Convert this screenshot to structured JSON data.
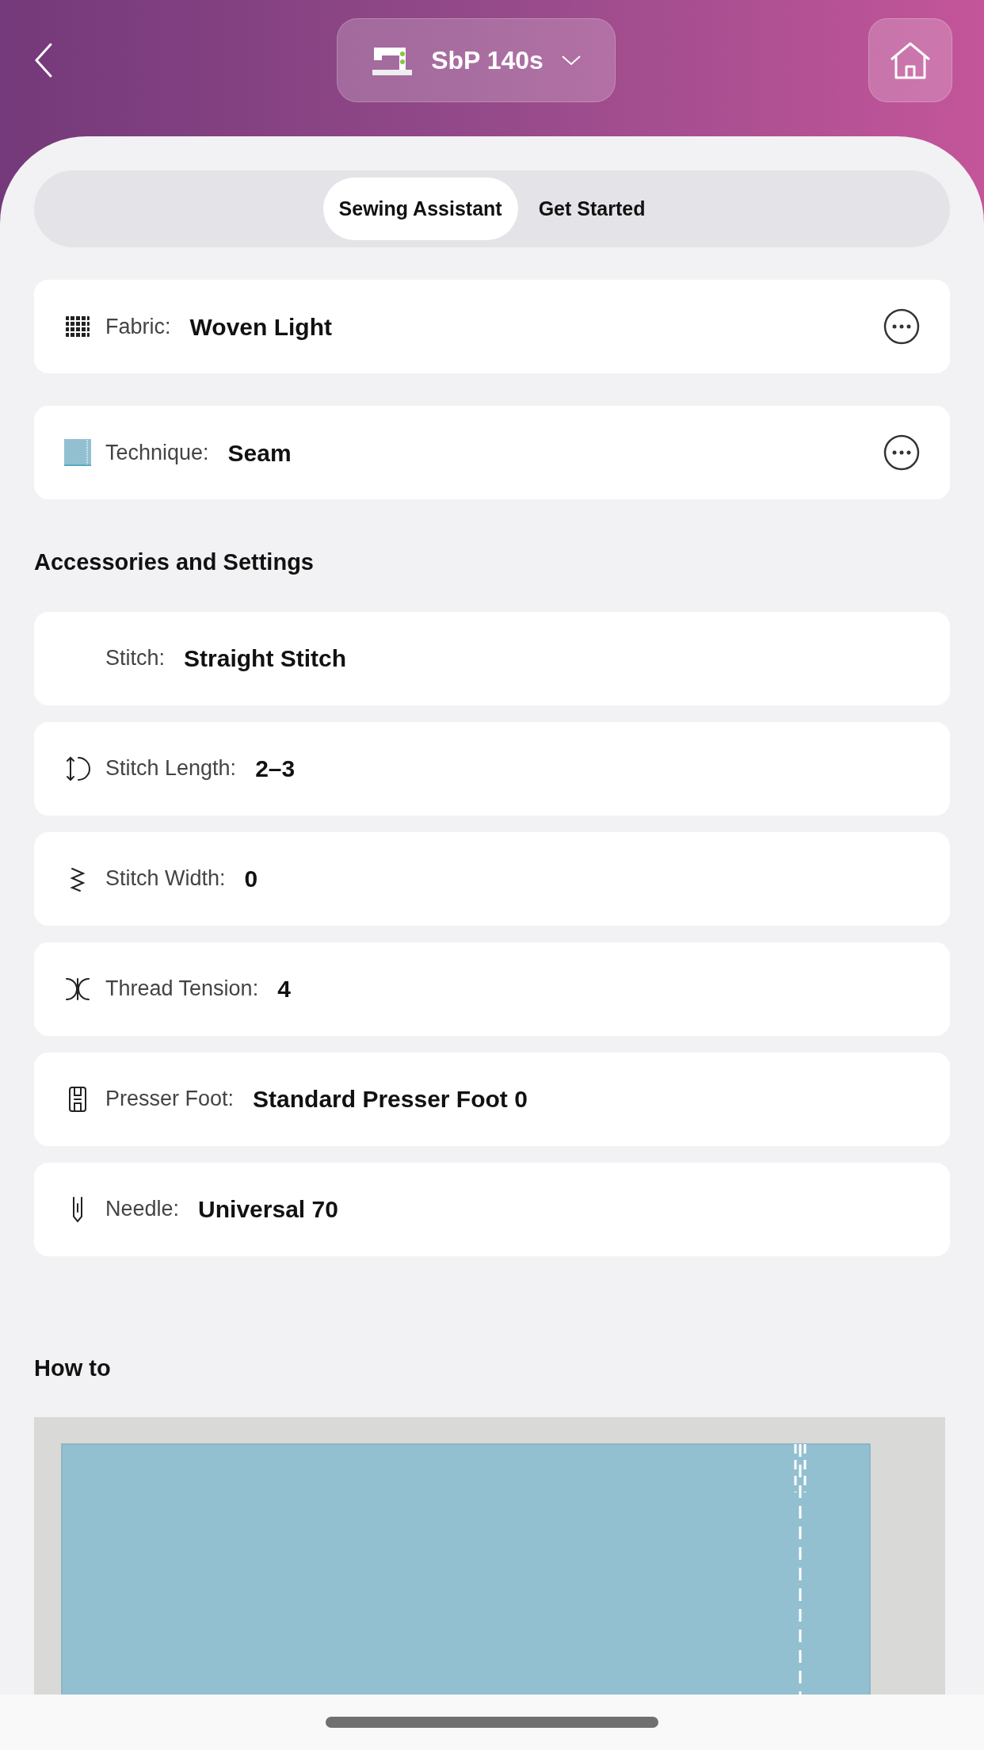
{
  "header": {
    "device": "SbP 140s"
  },
  "tabs": [
    {
      "label": "Sewing Assistant",
      "selected": true
    },
    {
      "label": "Get Started",
      "selected": false
    }
  ],
  "selections": [
    {
      "label": "Fabric:",
      "value": "Woven Light"
    },
    {
      "label": "Technique:",
      "value": "Seam"
    }
  ],
  "settings_title": "Accessories and Settings",
  "settings": [
    {
      "label": "Stitch:",
      "value": "Straight Stitch"
    },
    {
      "label": "Stitch Length:",
      "value": "2–3"
    },
    {
      "label": "Stitch Width:",
      "value": "0"
    },
    {
      "label": "Thread Tension:",
      "value": "4"
    },
    {
      "label": "Presser Foot:",
      "value": "Standard Presser Foot 0"
    },
    {
      "label": "Needle:",
      "value": "Universal 70"
    }
  ],
  "how_to_title": "How to"
}
